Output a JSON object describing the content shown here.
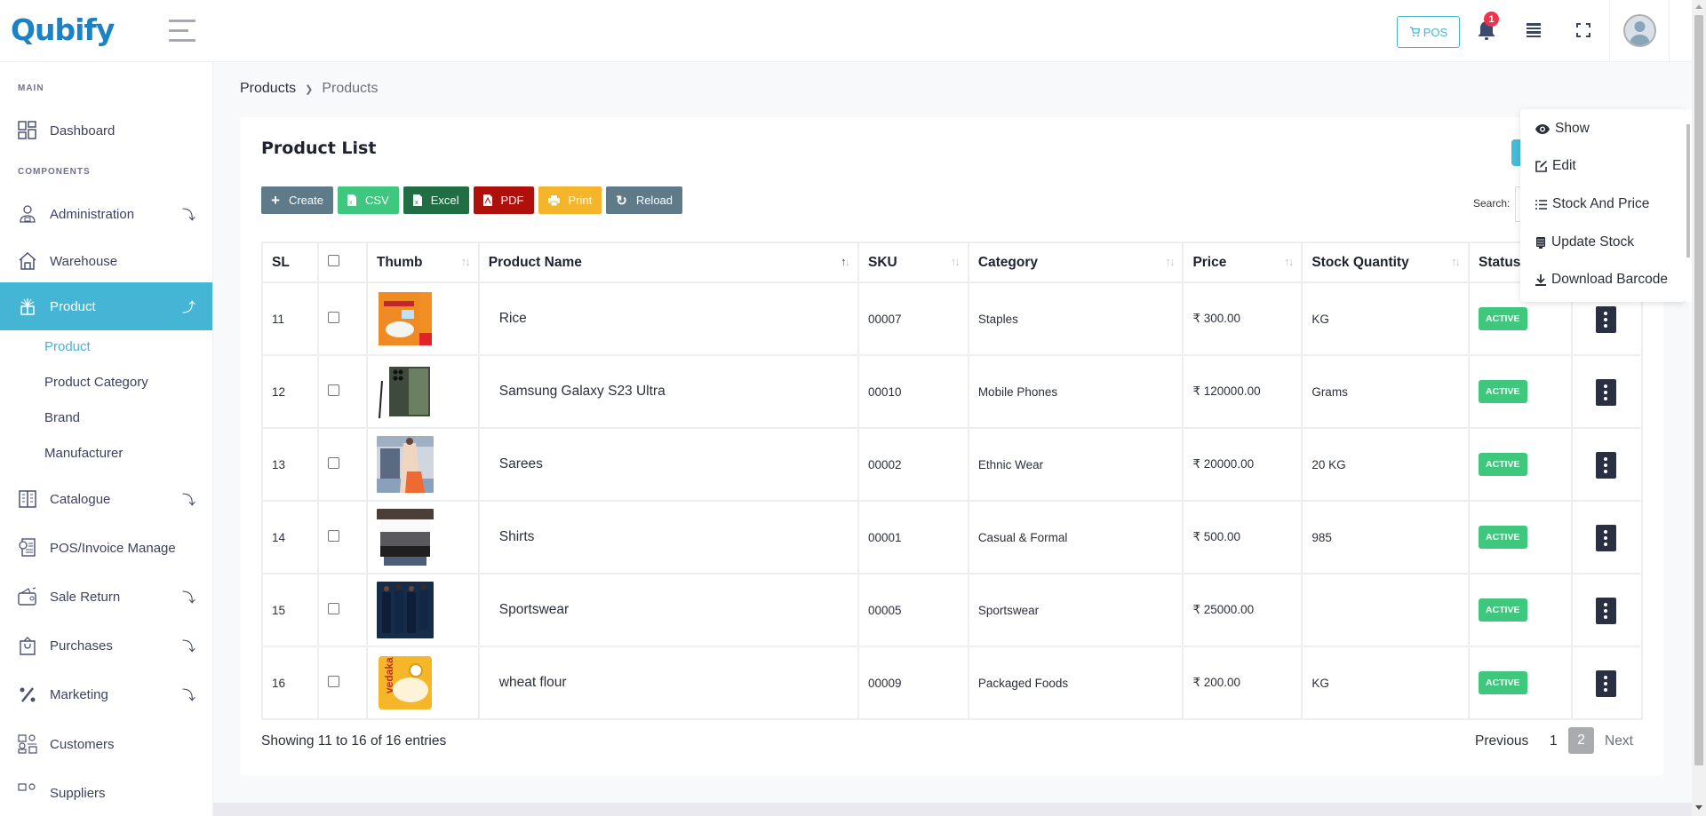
{
  "app": {
    "logo": "Qubify"
  },
  "topbar": {
    "pos_label": "POS",
    "notification_count": "1"
  },
  "sidebar": {
    "main_label": "MAIN",
    "components_label": "COMPONENTS",
    "items": [
      {
        "label": "Dashboard",
        "icon": "dashboard-grid-icon"
      },
      {
        "label": "Administration",
        "icon": "admin-user-icon",
        "chevron": "⤵"
      },
      {
        "label": "Warehouse",
        "icon": "warehouse-house-icon"
      },
      {
        "label": "Product",
        "icon": "product-box-icon",
        "chevron": "⤴"
      },
      {
        "label": "Catalogue",
        "icon": "catalogue-book-icon",
        "chevron": "⤵"
      },
      {
        "label": "POS/Invoice Manage",
        "icon": "invoice-icon"
      },
      {
        "label": "Sale Return",
        "icon": "wallet-icon",
        "chevron": "⤵"
      },
      {
        "label": "Purchases",
        "icon": "shopping-bag-icon",
        "chevron": "⤵"
      },
      {
        "label": "Marketing",
        "icon": "percent-icon",
        "chevron": "⤵"
      },
      {
        "label": "Customers",
        "icon": "customers-icon"
      },
      {
        "label": "Suppliers",
        "icon": "suppliers-icon"
      }
    ],
    "product_sub": [
      "Product",
      "Product Category",
      "Brand",
      "Manufacturer"
    ]
  },
  "breadcrumb": {
    "root": "Products",
    "current": "Products"
  },
  "card": {
    "title": "Product List",
    "toolbar": {
      "create": "Create",
      "csv": "CSV",
      "excel": "Excel",
      "pdf": "PDF",
      "print": "Print",
      "reload": "Reload"
    },
    "search_label": "Search:"
  },
  "table": {
    "headers": [
      "SL",
      "",
      "Thumb",
      "Product Name",
      "SKU",
      "Category",
      "Price",
      "Stock Quantity",
      "Status",
      ""
    ],
    "rows": [
      {
        "sl": "11",
        "name": "Rice",
        "sku": "00007",
        "category": "Staples",
        "price": "₹ 300.00",
        "stock": "KG",
        "status": "ACTIVE"
      },
      {
        "sl": "12",
        "name": "Samsung Galaxy S23 Ultra",
        "sku": "00010",
        "category": "Mobile Phones",
        "price": "₹ 120000.00",
        "stock": "Grams",
        "status": "ACTIVE"
      },
      {
        "sl": "13",
        "name": "Sarees",
        "sku": "00002",
        "category": "Ethnic Wear",
        "price": "₹ 20000.00",
        "stock": "20 KG",
        "status": "ACTIVE"
      },
      {
        "sl": "14",
        "name": "Shirts",
        "sku": "00001",
        "category": "Casual & Formal",
        "price": "₹ 500.00",
        "stock": "985",
        "status": "ACTIVE"
      },
      {
        "sl": "15",
        "name": "Sportswear",
        "sku": "00005",
        "category": "Sportswear",
        "price": "₹ 25000.00",
        "stock": "",
        "status": "ACTIVE"
      },
      {
        "sl": "16",
        "name": "wheat flour",
        "sku": "00009",
        "category": "Packaged Foods",
        "price": "₹ 200.00",
        "stock": "KG",
        "status": "ACTIVE"
      }
    ]
  },
  "footer": {
    "info": "Showing 11 to 16 of 16 entries",
    "previous": "Previous",
    "pages": [
      "1",
      "2"
    ],
    "current_page": "2",
    "next": "Next"
  },
  "dropdown": {
    "items": [
      {
        "label": "Show",
        "icon": "eye-icon"
      },
      {
        "label": "Edit",
        "icon": "edit-icon"
      },
      {
        "label": "Stock And Price",
        "icon": "list-icon"
      },
      {
        "label": "Update Stock",
        "icon": "stack-icon"
      },
      {
        "label": "Download Barcode",
        "icon": "download-icon"
      }
    ]
  },
  "colors": {
    "brand": "#1b82c5",
    "accent": "#45b5d6",
    "active_status": "#3fc77e",
    "csv": "#40c77f",
    "excel": "#216e45",
    "pdf": "#b0100b",
    "print": "#f5b52a",
    "create": "#5f7a88"
  }
}
